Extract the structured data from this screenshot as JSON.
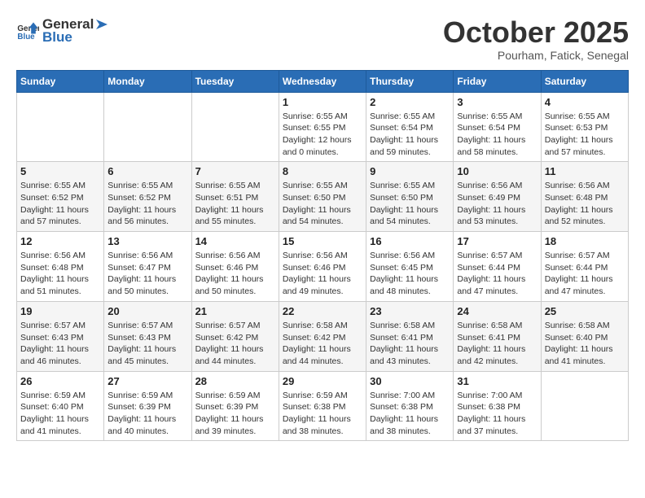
{
  "logo": {
    "general": "General",
    "blue": "Blue"
  },
  "title": "October 2025",
  "location": "Pourham, Fatick, Senegal",
  "days_of_week": [
    "Sunday",
    "Monday",
    "Tuesday",
    "Wednesday",
    "Thursday",
    "Friday",
    "Saturday"
  ],
  "weeks": [
    [
      {
        "day": "",
        "info": ""
      },
      {
        "day": "",
        "info": ""
      },
      {
        "day": "",
        "info": ""
      },
      {
        "day": "1",
        "info": "Sunrise: 6:55 AM\nSunset: 6:55 PM\nDaylight: 12 hours\nand 0 minutes."
      },
      {
        "day": "2",
        "info": "Sunrise: 6:55 AM\nSunset: 6:54 PM\nDaylight: 11 hours\nand 59 minutes."
      },
      {
        "day": "3",
        "info": "Sunrise: 6:55 AM\nSunset: 6:54 PM\nDaylight: 11 hours\nand 58 minutes."
      },
      {
        "day": "4",
        "info": "Sunrise: 6:55 AM\nSunset: 6:53 PM\nDaylight: 11 hours\nand 57 minutes."
      }
    ],
    [
      {
        "day": "5",
        "info": "Sunrise: 6:55 AM\nSunset: 6:52 PM\nDaylight: 11 hours\nand 57 minutes."
      },
      {
        "day": "6",
        "info": "Sunrise: 6:55 AM\nSunset: 6:52 PM\nDaylight: 11 hours\nand 56 minutes."
      },
      {
        "day": "7",
        "info": "Sunrise: 6:55 AM\nSunset: 6:51 PM\nDaylight: 11 hours\nand 55 minutes."
      },
      {
        "day": "8",
        "info": "Sunrise: 6:55 AM\nSunset: 6:50 PM\nDaylight: 11 hours\nand 54 minutes."
      },
      {
        "day": "9",
        "info": "Sunrise: 6:55 AM\nSunset: 6:50 PM\nDaylight: 11 hours\nand 54 minutes."
      },
      {
        "day": "10",
        "info": "Sunrise: 6:56 AM\nSunset: 6:49 PM\nDaylight: 11 hours\nand 53 minutes."
      },
      {
        "day": "11",
        "info": "Sunrise: 6:56 AM\nSunset: 6:48 PM\nDaylight: 11 hours\nand 52 minutes."
      }
    ],
    [
      {
        "day": "12",
        "info": "Sunrise: 6:56 AM\nSunset: 6:48 PM\nDaylight: 11 hours\nand 51 minutes."
      },
      {
        "day": "13",
        "info": "Sunrise: 6:56 AM\nSunset: 6:47 PM\nDaylight: 11 hours\nand 50 minutes."
      },
      {
        "day": "14",
        "info": "Sunrise: 6:56 AM\nSunset: 6:46 PM\nDaylight: 11 hours\nand 50 minutes."
      },
      {
        "day": "15",
        "info": "Sunrise: 6:56 AM\nSunset: 6:46 PM\nDaylight: 11 hours\nand 49 minutes."
      },
      {
        "day": "16",
        "info": "Sunrise: 6:56 AM\nSunset: 6:45 PM\nDaylight: 11 hours\nand 48 minutes."
      },
      {
        "day": "17",
        "info": "Sunrise: 6:57 AM\nSunset: 6:44 PM\nDaylight: 11 hours\nand 47 minutes."
      },
      {
        "day": "18",
        "info": "Sunrise: 6:57 AM\nSunset: 6:44 PM\nDaylight: 11 hours\nand 47 minutes."
      }
    ],
    [
      {
        "day": "19",
        "info": "Sunrise: 6:57 AM\nSunset: 6:43 PM\nDaylight: 11 hours\nand 46 minutes."
      },
      {
        "day": "20",
        "info": "Sunrise: 6:57 AM\nSunset: 6:43 PM\nDaylight: 11 hours\nand 45 minutes."
      },
      {
        "day": "21",
        "info": "Sunrise: 6:57 AM\nSunset: 6:42 PM\nDaylight: 11 hours\nand 44 minutes."
      },
      {
        "day": "22",
        "info": "Sunrise: 6:58 AM\nSunset: 6:42 PM\nDaylight: 11 hours\nand 44 minutes."
      },
      {
        "day": "23",
        "info": "Sunrise: 6:58 AM\nSunset: 6:41 PM\nDaylight: 11 hours\nand 43 minutes."
      },
      {
        "day": "24",
        "info": "Sunrise: 6:58 AM\nSunset: 6:41 PM\nDaylight: 11 hours\nand 42 minutes."
      },
      {
        "day": "25",
        "info": "Sunrise: 6:58 AM\nSunset: 6:40 PM\nDaylight: 11 hours\nand 41 minutes."
      }
    ],
    [
      {
        "day": "26",
        "info": "Sunrise: 6:59 AM\nSunset: 6:40 PM\nDaylight: 11 hours\nand 41 minutes."
      },
      {
        "day": "27",
        "info": "Sunrise: 6:59 AM\nSunset: 6:39 PM\nDaylight: 11 hours\nand 40 minutes."
      },
      {
        "day": "28",
        "info": "Sunrise: 6:59 AM\nSunset: 6:39 PM\nDaylight: 11 hours\nand 39 minutes."
      },
      {
        "day": "29",
        "info": "Sunrise: 6:59 AM\nSunset: 6:38 PM\nDaylight: 11 hours\nand 38 minutes."
      },
      {
        "day": "30",
        "info": "Sunrise: 7:00 AM\nSunset: 6:38 PM\nDaylight: 11 hours\nand 38 minutes."
      },
      {
        "day": "31",
        "info": "Sunrise: 7:00 AM\nSunset: 6:38 PM\nDaylight: 11 hours\nand 37 minutes."
      },
      {
        "day": "",
        "info": ""
      }
    ]
  ]
}
